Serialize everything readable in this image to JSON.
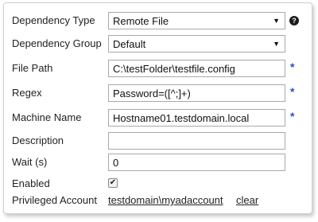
{
  "form": {
    "dependency_type": {
      "label": "Dependency Type",
      "value": "Remote File"
    },
    "dependency_group": {
      "label": "Dependency Group",
      "value": "Default"
    },
    "file_path": {
      "label": "File Path",
      "value": "C:\\testFolder\\testfile.config",
      "required": "*"
    },
    "regex": {
      "label": "Regex",
      "value": "Password=([^;]+)",
      "required": "*"
    },
    "machine_name": {
      "label": "Machine Name",
      "value": "Hostname01.testdomain.local",
      "required": "*"
    },
    "description": {
      "label": "Description",
      "value": ""
    },
    "wait": {
      "label": "Wait (s)",
      "value": "0"
    },
    "enabled": {
      "label": "Enabled",
      "checked": true,
      "check_glyph": "✔"
    },
    "privileged_account": {
      "label": "Privileged Account",
      "value": "testdomain\\myadaccount",
      "clear_label": "clear"
    }
  },
  "icons": {
    "dropdown": "caret-down-icon",
    "help": "question-circle-icon"
  },
  "colors": {
    "required_marker": "#2a4fd0",
    "field_border": "#a9a9a9",
    "panel_border": "#cfcfcf"
  }
}
